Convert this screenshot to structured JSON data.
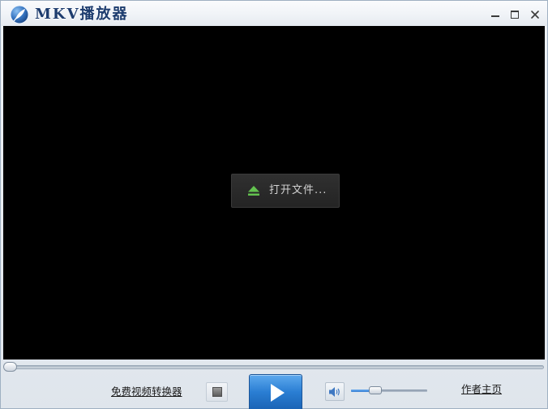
{
  "window": {
    "title": "MKV播放器",
    "logo_icon": "feather-logo-icon",
    "minimize_icon": "minimize-icon",
    "maximize_icon": "maximize-icon",
    "close_icon": "close-icon"
  },
  "video": {
    "open_file_label": "打开文件...",
    "open_file_icon": "eject-icon"
  },
  "seek": {
    "position": 0
  },
  "toolbar": {
    "converter_link": "免费视频转换器",
    "stop_icon": "stop-icon",
    "play_icon": "play-icon",
    "volume_icon": "speaker-icon",
    "volume_level": 0.32,
    "author_link": "作者主页"
  },
  "colors": {
    "title_text": "#1d3c6e",
    "video_background": "#000000",
    "eject_icon": "#63c24f",
    "play_button": "#2a7ed3",
    "volume_fill": "#3a80d2"
  }
}
